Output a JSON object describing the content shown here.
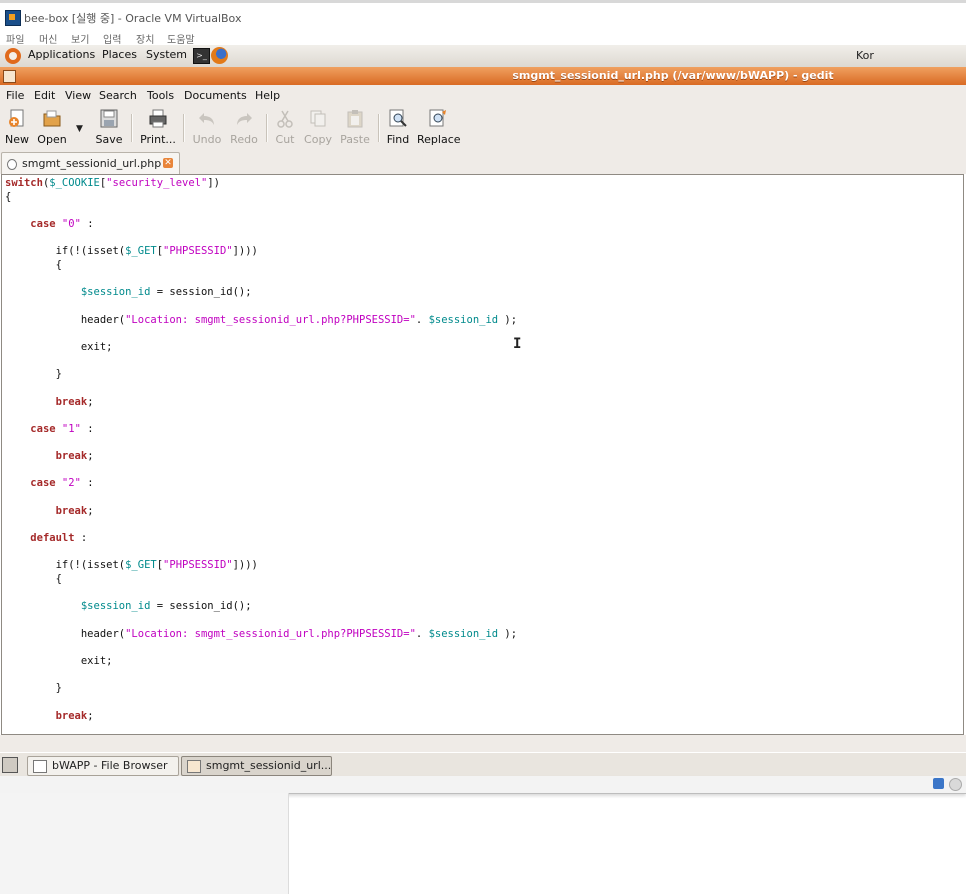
{
  "host": {
    "title": "bee-box [실행 중] - Oracle VM VirtualBox",
    "menu": [
      "파일",
      "머신",
      "보기",
      "입력",
      "장치",
      "도움말"
    ]
  },
  "panel": {
    "applications": "Applications",
    "places": "Places",
    "system": "System",
    "keyboard": "Kor"
  },
  "gedit": {
    "title": "smgmt_sessionid_url.php (/var/www/bWAPP) - gedit",
    "menu": [
      "File",
      "Edit",
      "View",
      "Search",
      "Tools",
      "Documents",
      "Help"
    ],
    "toolbar": {
      "new": "New",
      "open": "Open",
      "save": "Save",
      "print": "Print...",
      "undo": "Undo",
      "redo": "Redo",
      "cut": "Cut",
      "copy": "Copy",
      "paste": "Paste",
      "find": "Find",
      "replace": "Replace"
    },
    "tab": "smgmt_sessionid_url.php",
    "code": [
      "switch($_COOKIE[\"security_level\"])",
      "{",
      "",
      "    case \"0\" :",
      "",
      "        if(!(isset($_GET[\"PHPSESSID\"])))",
      "        {",
      "",
      "            $session_id = session_id();",
      "",
      "            header(\"Location: smgmt_sessionid_url.php?PHPSESSID=\". $session_id );",
      "",
      "            exit;",
      "",
      "        }",
      "",
      "        break;",
      "",
      "    case \"1\" :",
      "",
      "        break;",
      "",
      "    case \"2\" :",
      "",
      "        break;",
      "",
      "    default :",
      "",
      "        if(!(isset($_GET[\"PHPSESSID\"])))",
      "        {",
      "",
      "            $session_id = session_id();",
      "",
      "            header(\"Location: smgmt_sessionid_url.php?PHPSESSID=\". $session_id );",
      "",
      "            exit;",
      "",
      "        }",
      "",
      "        break;"
    ]
  },
  "taskbar": {
    "items": [
      "bWAPP - File Browser",
      "smgmt_sessionid_url..."
    ]
  }
}
